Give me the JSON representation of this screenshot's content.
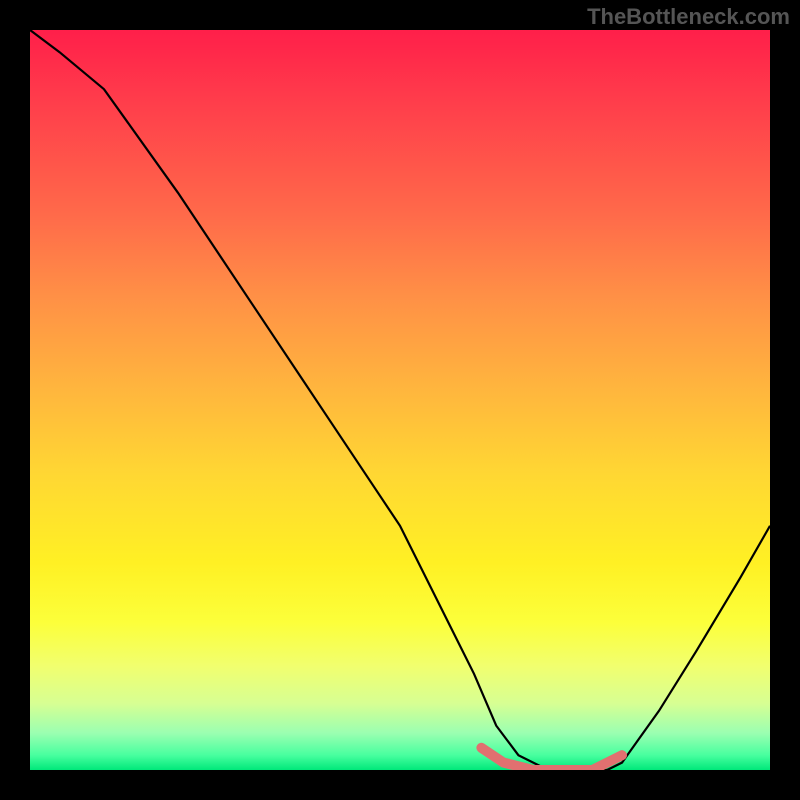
{
  "watermark": "TheBottleneck.com",
  "chart_data": {
    "type": "line",
    "title": "",
    "xlabel": "",
    "ylabel": "",
    "xlim": [
      0,
      100
    ],
    "ylim": [
      0,
      100
    ],
    "series": [
      {
        "name": "curve",
        "color": "#000000",
        "x": [
          0,
          4,
          10,
          20,
          30,
          40,
          50,
          60,
          63,
          66,
          70,
          74,
          78,
          80,
          85,
          90,
          96,
          100
        ],
        "values": [
          100,
          97,
          92,
          78,
          63,
          48,
          33,
          13,
          6,
          2,
          0,
          0,
          0,
          1,
          8,
          16,
          26,
          33
        ]
      },
      {
        "name": "bottom-band",
        "color": "#e17070",
        "x": [
          61,
          64,
          68,
          72,
          76,
          80
        ],
        "values": [
          3,
          1,
          0,
          0,
          0,
          2
        ]
      }
    ],
    "gradient_stops": [
      {
        "pos": 0,
        "color": "#ff1f4a"
      },
      {
        "pos": 10,
        "color": "#ff3e4b"
      },
      {
        "pos": 25,
        "color": "#ff6a4a"
      },
      {
        "pos": 36,
        "color": "#ff9046"
      },
      {
        "pos": 48,
        "color": "#ffb43e"
      },
      {
        "pos": 60,
        "color": "#ffd733"
      },
      {
        "pos": 72,
        "color": "#fff024"
      },
      {
        "pos": 80,
        "color": "#fcff3a"
      },
      {
        "pos": 86,
        "color": "#f1ff6f"
      },
      {
        "pos": 91,
        "color": "#d7ff93"
      },
      {
        "pos": 95,
        "color": "#9bffb1"
      },
      {
        "pos": 98,
        "color": "#48ff9f"
      },
      {
        "pos": 100,
        "color": "#00e87a"
      }
    ]
  }
}
